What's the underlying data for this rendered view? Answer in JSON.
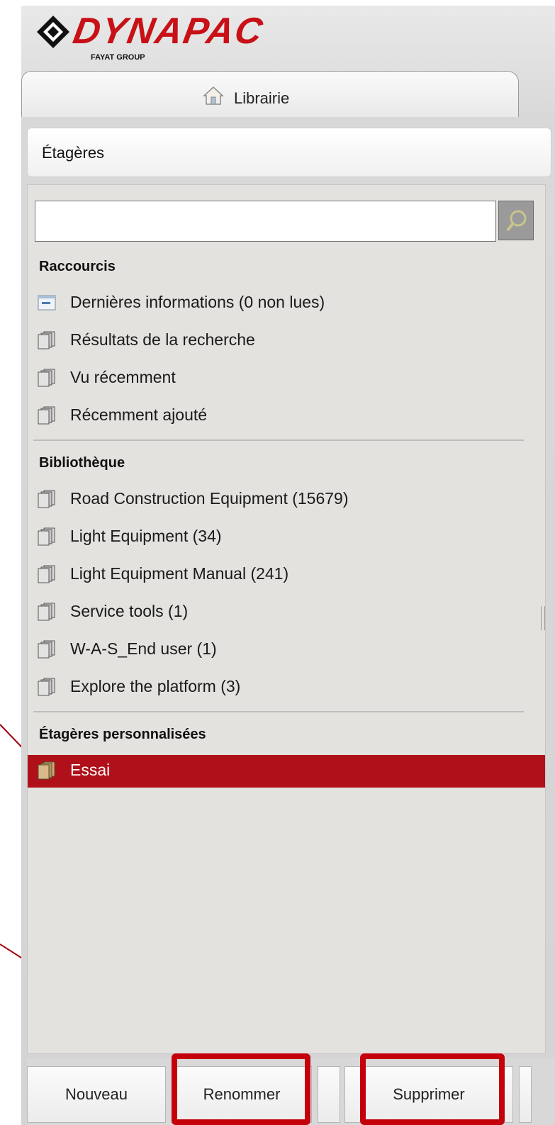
{
  "brand": {
    "name": "DYNAPAC",
    "sub": "FAYAT GROUP"
  },
  "tab": {
    "label": "Librairie"
  },
  "header": {
    "title": "Étagères"
  },
  "search": {
    "value": "",
    "placeholder": ""
  },
  "sections": [
    {
      "title": "Raccourcis",
      "items": [
        "Dernières informations (0 non lues)",
        "Résultats de la recherche",
        "Vu récemment",
        "Récemment ajouté"
      ]
    },
    {
      "title": "Bibliothèque",
      "items": [
        "Road Construction Equipment (15679)",
        "Light Equipment (34)",
        "Light Equipment Manual (241)",
        "Service tools (1)",
        "W-A-S_End user (1)",
        "Explore the platform (3)"
      ]
    },
    {
      "title": "Étagères personnalisées",
      "items": [
        "Essai"
      ]
    }
  ],
  "footer": {
    "new": "Nouveau",
    "rename": "Renommer",
    "delete": "Supprimer"
  },
  "colors": {
    "accent": "#b0101a",
    "brand": "#c81017",
    "highlight": "#c4000b"
  }
}
